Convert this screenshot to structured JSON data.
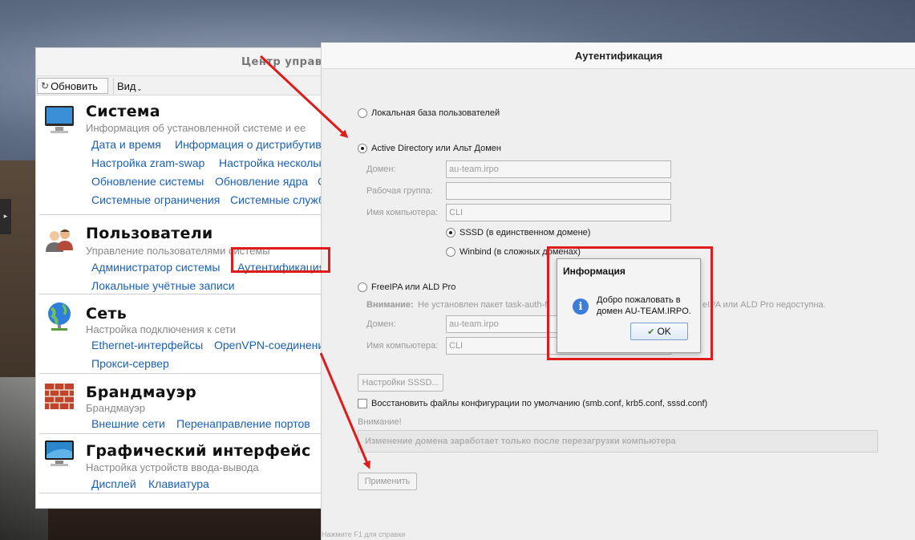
{
  "control_center": {
    "title": "Центр управ",
    "toolbar": {
      "refresh_label": "Обновить",
      "view_label": "Вид"
    },
    "sections": [
      {
        "title": "Система",
        "description": "Информация об установленной системе и ее",
        "links": [
          "Дата и время",
          "Информация о дистрибутив",
          "Настройка zram-swap",
          "Настройка нескольк",
          "Обновление системы",
          "Обновление ядра",
          "С",
          "Системные ограничения",
          "Системные служб"
        ]
      },
      {
        "title": "Пользователи",
        "description": "Управление пользователями системы",
        "links": [
          "Администратор системы",
          "Аутентификация",
          "Локальные учётные записи"
        ]
      },
      {
        "title": "Сеть",
        "description": "Настройка подключения к сети",
        "links": [
          "Ethernet-интерфейсы",
          "OpenVPN-соединени",
          "Прокси-сервер"
        ]
      },
      {
        "title": "Брандмауэр",
        "description": "Брандмауэр",
        "links": [
          "Внешние сети",
          "Перенаправление портов"
        ]
      },
      {
        "title": "Графический интерфейс",
        "description": "Настройка устройств ввода-вывода",
        "links": [
          "Дисплей",
          "Клавиатура"
        ]
      }
    ]
  },
  "auth_dialog": {
    "title": "Аутентификация",
    "local_db_label": "Локальная база пользователей",
    "ad_label": "Active Directory или Альт Домен",
    "ad": {
      "domain_label": "Домен:",
      "domain_value": "au-team.irpo",
      "workgroup_label": "Рабочая группа:",
      "workgroup_value": "",
      "hostname_label": "Имя компьютера:",
      "hostname_value": "CLI",
      "sssd_label": "SSSD (в единственном домене)",
      "winbind_label": "Winbind (в сложных доменах)"
    },
    "freeipa_label": "FreeIPA или ALD Pro",
    "freeipa": {
      "warning_prefix": "Внимание:",
      "warning_left": "Не установлен пакет task-auth-f",
      "warning_right": "eIPA или ALD Pro недоступна.",
      "domain_label": "Домен:",
      "domain_value": "au-team.irpo",
      "hostname_label": "Имя компьютера:",
      "hostname_value": "CLI"
    },
    "sssd_settings_button": "Настройки SSSD...",
    "restore_config_label": "Восстановить файлы конфигурации по умолчанию (smb.conf, krb5.conf, sssd.conf)",
    "attention_label": "Внимание!",
    "attention_note": "Изменение домена заработает только после перезагрузки компьютера",
    "apply_button": "Применить",
    "status_hint": "Нажмите F1 для справки"
  },
  "info_popup": {
    "title": "Информация",
    "message": "Добро пожаловать в домен AU-TEAM.IRPO.",
    "ok_label": "OK",
    "icon": "info-icon"
  },
  "annotation_color": "#e01b1b"
}
